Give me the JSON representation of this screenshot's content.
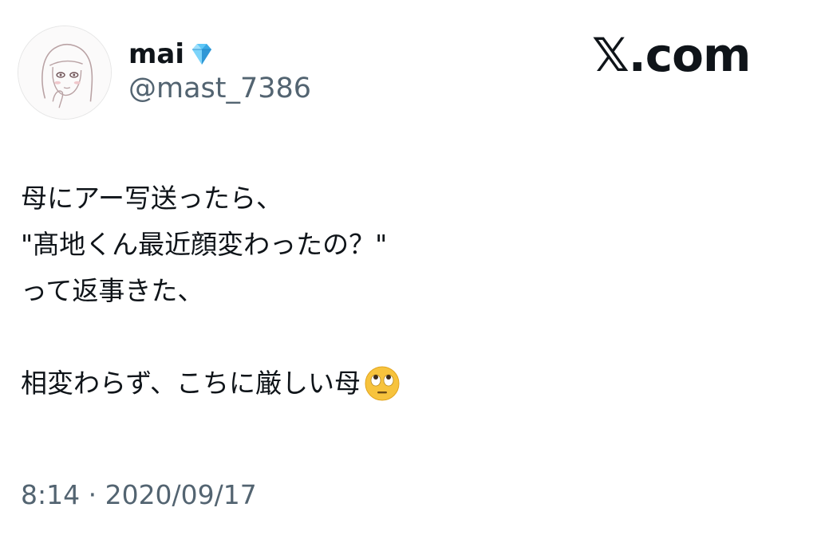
{
  "user": {
    "display_name": "mai",
    "name_emoji": "gem-stone-icon",
    "handle": "@mast_7386",
    "avatar": "profile-avatar"
  },
  "brand": {
    "text": "𝕏.com"
  },
  "tweet": {
    "lines": [
      "母にアー写送ったら、",
      "\"髙地くん最近顔変わったの？\"",
      "って返事きた、",
      "",
      "相変わらず、こちに厳しい母"
    ],
    "trailing_emoji": "face-with-rolling-eyes-icon"
  },
  "timestamp": "8:14 · 2020/09/17",
  "colors": {
    "text_primary": "#0f1419",
    "text_secondary": "#536471",
    "gem": "#5ec7f7",
    "emoji_face": "#f7c33d"
  }
}
